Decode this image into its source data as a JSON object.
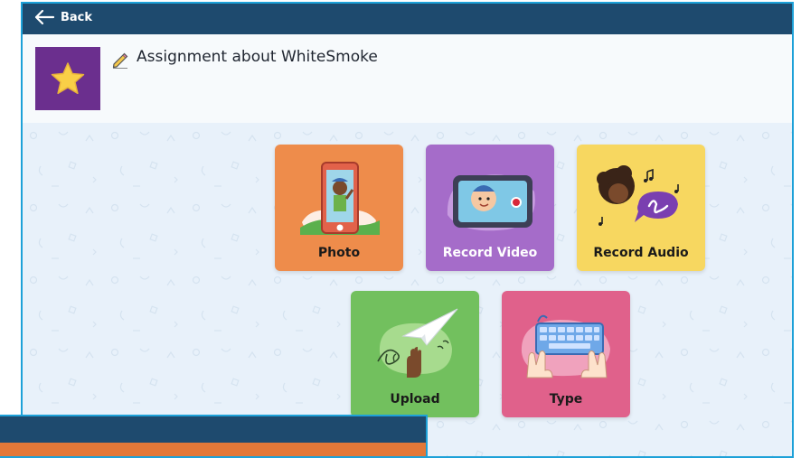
{
  "topbar": {
    "back_label": "Back"
  },
  "assignment": {
    "title": "Assignment about WhiteSmoke"
  },
  "options": [
    {
      "label": "Photo"
    },
    {
      "label": "Record Video"
    },
    {
      "label": "Record Audio"
    },
    {
      "label": "Upload"
    },
    {
      "label": "Type"
    }
  ],
  "colors": {
    "topbar": "#1e4a6e",
    "border": "#1da1d8",
    "photo": "#ee8c4b",
    "video": "#a56cc9",
    "audio": "#f7d760",
    "upload": "#72c05e",
    "type": "#e0618b",
    "thumb": "#6b2f8e",
    "star": "#f9cf47"
  },
  "icons": [
    "arrow-left-icon",
    "pencil-icon",
    "star-icon"
  ]
}
